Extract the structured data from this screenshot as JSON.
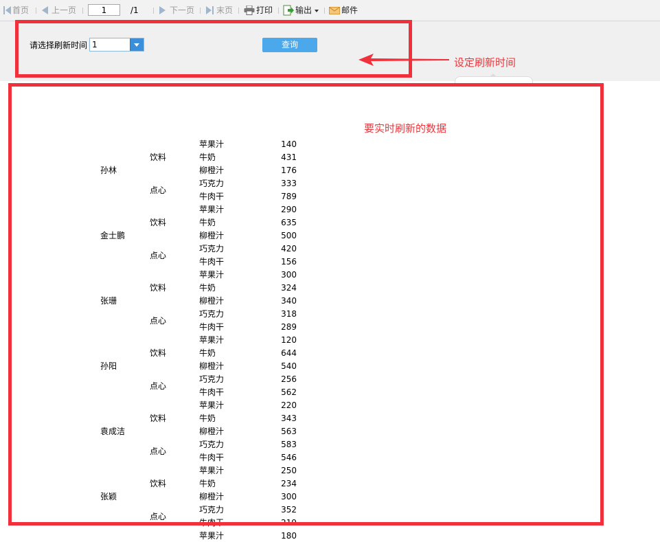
{
  "toolbar": {
    "first": "首页",
    "prev": "上一页",
    "page_value": "1",
    "page_total": "/1",
    "next": "下一页",
    "last": "末页",
    "print": "打印",
    "export": "输出",
    "email": "邮件"
  },
  "params": {
    "label": "请选择刷新时间",
    "refresh_value": "1",
    "query": "查询"
  },
  "annotations": {
    "set_refresh": "设定刷新时间",
    "realtime_data": "要实时刷新的数据",
    "color": "#f0303a"
  },
  "report": {
    "rows": [
      {
        "person": "孙林",
        "category": "饮料",
        "product": "苹果汁",
        "value": "140"
      },
      {
        "person": "",
        "category": "",
        "product": "牛奶",
        "value": "431"
      },
      {
        "person": "",
        "category": "",
        "product": "柳橙汁",
        "value": "176"
      },
      {
        "person": "",
        "category": "点心",
        "product": "巧克力",
        "value": "333"
      },
      {
        "person": "",
        "category": "",
        "product": "牛肉干",
        "value": "789"
      },
      {
        "person": "金士鹏",
        "category": "饮料",
        "product": "苹果汁",
        "value": "290"
      },
      {
        "person": "",
        "category": "",
        "product": "牛奶",
        "value": "635"
      },
      {
        "person": "",
        "category": "",
        "product": "柳橙汁",
        "value": "500"
      },
      {
        "person": "",
        "category": "点心",
        "product": "巧克力",
        "value": "420"
      },
      {
        "person": "",
        "category": "",
        "product": "牛肉干",
        "value": "156"
      },
      {
        "person": "张珊",
        "category": "饮料",
        "product": "苹果汁",
        "value": "300"
      },
      {
        "person": "",
        "category": "",
        "product": "牛奶",
        "value": "324"
      },
      {
        "person": "",
        "category": "",
        "product": "柳橙汁",
        "value": "340"
      },
      {
        "person": "",
        "category": "点心",
        "product": "巧克力",
        "value": "318"
      },
      {
        "person": "",
        "category": "",
        "product": "牛肉干",
        "value": "289"
      },
      {
        "person": "孙阳",
        "category": "饮料",
        "product": "苹果汁",
        "value": "120"
      },
      {
        "person": "",
        "category": "",
        "product": "牛奶",
        "value": "644"
      },
      {
        "person": "",
        "category": "",
        "product": "柳橙汁",
        "value": "540"
      },
      {
        "person": "",
        "category": "点心",
        "product": "巧克力",
        "value": "256"
      },
      {
        "person": "",
        "category": "",
        "product": "牛肉干",
        "value": "562"
      },
      {
        "person": "袁成洁",
        "category": "饮料",
        "product": "苹果汁",
        "value": "220"
      },
      {
        "person": "",
        "category": "",
        "product": "牛奶",
        "value": "343"
      },
      {
        "person": "",
        "category": "",
        "product": "柳橙汁",
        "value": "563"
      },
      {
        "person": "",
        "category": "点心",
        "product": "巧克力",
        "value": "583"
      },
      {
        "person": "",
        "category": "",
        "product": "牛肉干",
        "value": "546"
      },
      {
        "person": "张颖",
        "category": "饮料",
        "product": "苹果汁",
        "value": "250"
      },
      {
        "person": "",
        "category": "",
        "product": "牛奶",
        "value": "234"
      },
      {
        "person": "",
        "category": "",
        "product": "柳橙汁",
        "value": "300"
      },
      {
        "person": "",
        "category": "点心",
        "product": "巧克力",
        "value": "352"
      },
      {
        "person": "",
        "category": "",
        "product": "牛肉干",
        "value": "219"
      },
      {
        "person": "",
        "category": "",
        "product": "苹果汁",
        "value": "180"
      }
    ]
  }
}
